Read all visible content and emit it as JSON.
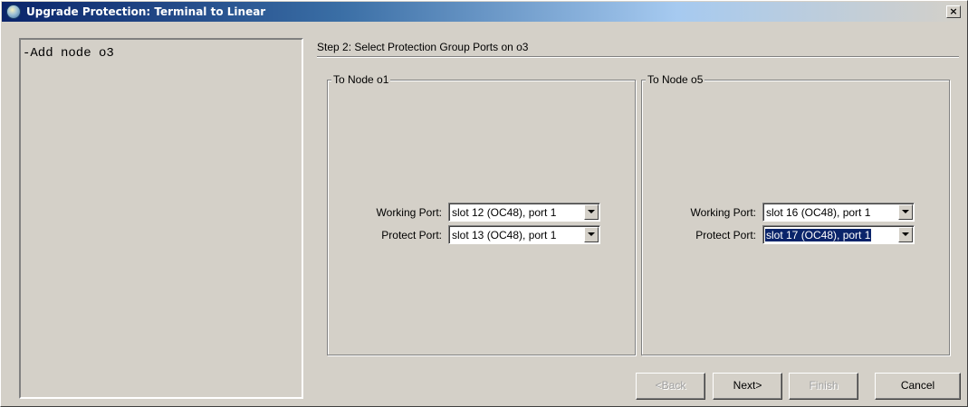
{
  "window": {
    "title": "Upgrade Protection: Terminal to Linear",
    "close_label": "×"
  },
  "log": {
    "lines": [
      "-Add node o3"
    ]
  },
  "step": {
    "title": "Step 2: Select Protection Group Ports on o3"
  },
  "groups": [
    {
      "title": "To Node o1",
      "working_label": "Working Port:",
      "working_value": "slot 12 (OC48), port 1",
      "protect_label": "Protect Port:",
      "protect_value": "slot 13 (OC48), port 1"
    },
    {
      "title": "To Node o5",
      "working_label": "Working Port:",
      "working_value": "slot 16 (OC48), port 1",
      "protect_label": "Protect Port:",
      "protect_value": "slot 17 (OC48), port 1"
    }
  ],
  "buttons": {
    "back": "<Back",
    "next": "Next>",
    "finish": "Finish",
    "cancel": "Cancel"
  },
  "colors": {
    "title_bar_start": "#0a246a",
    "selection": "#0a246a",
    "face": "#d4d0c8"
  },
  "icons": {
    "app": "globe-icon",
    "close": "close-icon",
    "dropdown": "chevron-down-icon"
  }
}
